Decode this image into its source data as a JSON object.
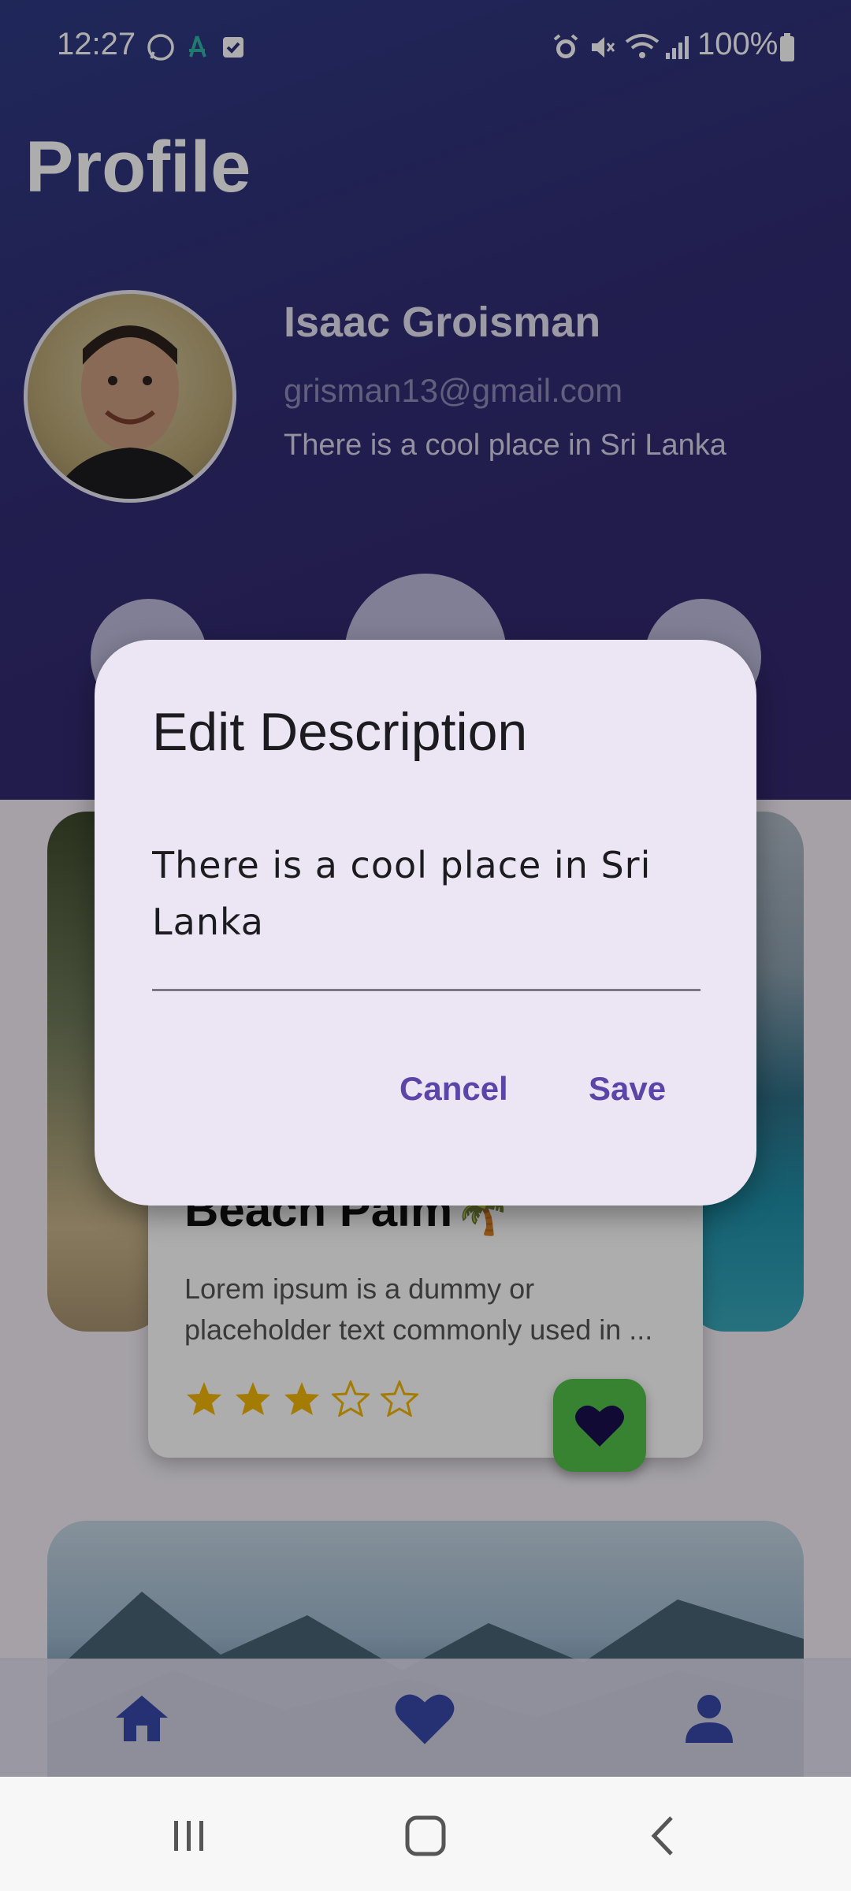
{
  "status_bar": {
    "time": "12:27",
    "battery": "100%",
    "left_icons": [
      "whatsapp-icon",
      "app-notification-icon",
      "checkbox-notification-icon"
    ],
    "right_icons": [
      "alarm-icon",
      "mute-icon",
      "wifi-icon",
      "signal-icon",
      "battery-icon"
    ]
  },
  "profile": {
    "title": "Profile",
    "name": "Isaac Groisman",
    "email": "grisman13@gmail.com",
    "description": "There is a cool place in Sri Lanka"
  },
  "place_card": {
    "title": "Beach Palm🌴",
    "body_line1": "Lorem ipsum is a dummy or",
    "body_line2": "placeholder text commonly used in ...",
    "rating": 3,
    "max_rating": 5
  },
  "bottom_nav": {
    "items": [
      {
        "icon": "home-icon"
      },
      {
        "icon": "heart-icon"
      },
      {
        "icon": "person-icon"
      }
    ]
  },
  "dialog": {
    "title": "Edit Description",
    "field_value": "There is a cool place in Sri Lanka",
    "cancel_label": "Cancel",
    "save_label": "Save"
  },
  "colors": {
    "header": "#322b72",
    "accent": "#5b45a8",
    "dialog_bg": "#ece6f4",
    "fav_button": "#53c24a",
    "star": "#f2b705"
  }
}
